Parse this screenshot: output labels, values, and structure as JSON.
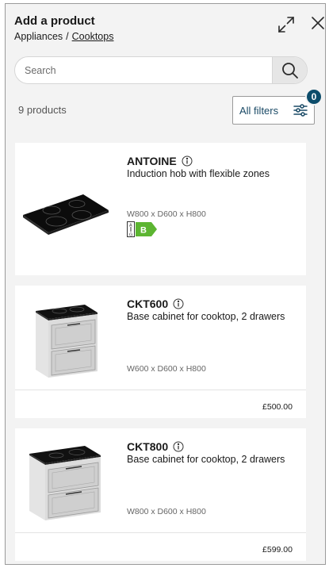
{
  "header": {
    "title": "Add a product",
    "breadcrumb": [
      "Appliances",
      "/",
      "Cooktops"
    ]
  },
  "search": {
    "placeholder": "Search"
  },
  "results": {
    "count_label": "9 products",
    "filters_label": "All filters",
    "filters_badge": "0"
  },
  "products": [
    {
      "name": "ANTOINE",
      "description": "Induction hob with flexible zones",
      "dimensions": "W800 x D600 x H800",
      "energy_class": "B",
      "energy_scale_top": "A",
      "energy_scale_bottom": "G",
      "energy_color": "#5cb531",
      "image": "induction-hob"
    },
    {
      "name": "CKT600",
      "description": "Base cabinet for cooktop, 2 drawers",
      "dimensions": "W600 x D600 x H800",
      "price": "£500.00",
      "image": "base-cabinet-with-hob"
    },
    {
      "name": "CKT800",
      "description": "Base cabinet for cooktop, 2 drawers",
      "dimensions": "W800 x D600 x H800",
      "price": "£599.00",
      "image": "base-cabinet-with-hob"
    }
  ],
  "colors": {
    "accent": "#0d4d6b",
    "link_text": "#1a4a66",
    "background": "#f3f3f3"
  }
}
